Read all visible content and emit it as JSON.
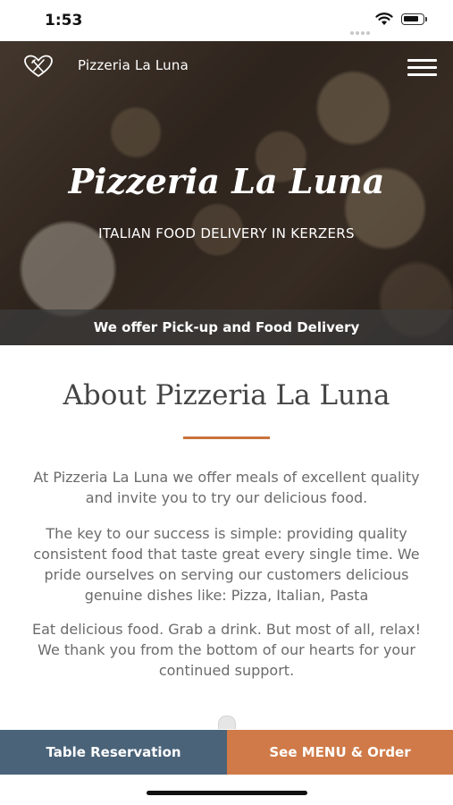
{
  "status": {
    "time": "1:53"
  },
  "header": {
    "brand": "Pizzeria La Luna"
  },
  "hero": {
    "title": "Pizzeria La Luna",
    "subtitle": "ITALIAN FOOD DELIVERY IN KERZERS",
    "offer": "We offer Pick-up and Food Delivery"
  },
  "about": {
    "title": "About Pizzeria La Luna",
    "paragraphs": [
      "At Pizzeria La Luna we offer meals of excellent quality and invite you to try our delicious food.",
      "The key to our success is simple: providing quality consistent food that taste great every single time. We pride ourselves on serving our customers delicious genuine dishes like: Pizza, Italian, Pasta",
      "Eat delicious food. Grab a drink. But most of all, relax! We thank you from the bottom of our hearts for your continued support."
    ]
  },
  "actions": {
    "reserve": "Table Reservation",
    "menu": "See MENU & Order"
  },
  "colors": {
    "accent": "#c8733d",
    "reserve_button": "#4a6379",
    "menu_button": "#cf7a48"
  },
  "icons": [
    "fork-knife-heart-icon",
    "hamburger-menu-icon",
    "wifi-icon",
    "battery-icon",
    "signal-icon"
  ]
}
